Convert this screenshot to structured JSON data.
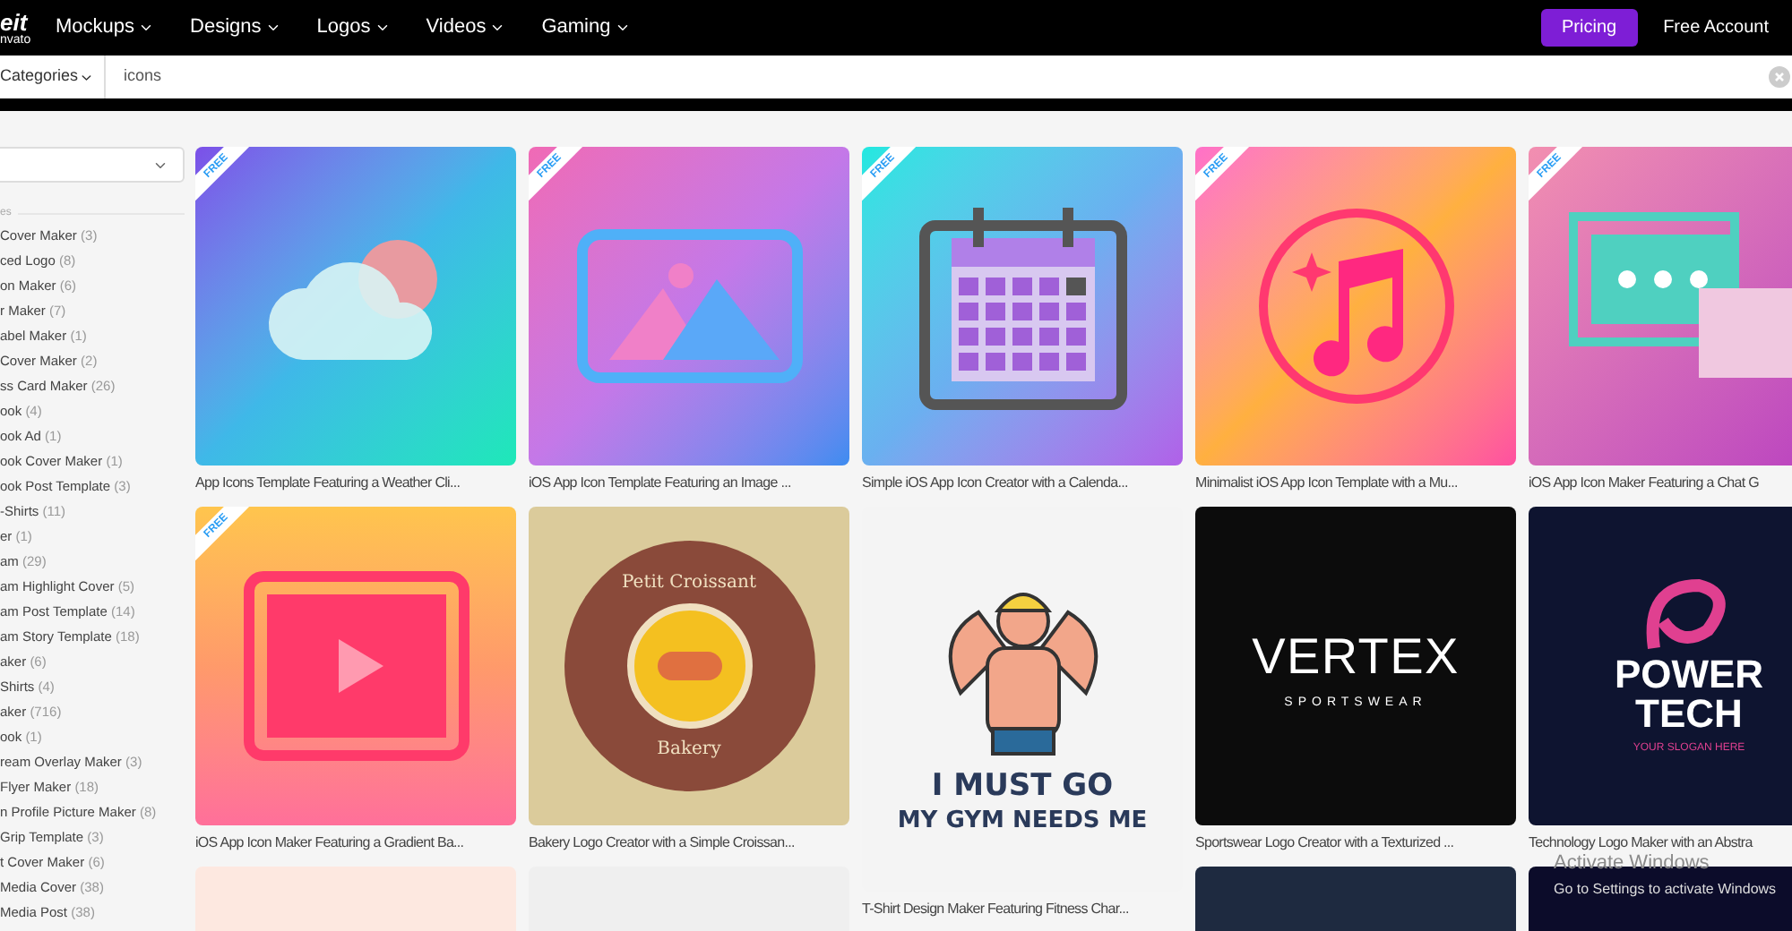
{
  "nav": {
    "logo": "eit",
    "logo_sub": "nvato",
    "items": [
      "Mockups",
      "Designs",
      "Logos",
      "Videos",
      "Gaming"
    ],
    "pricing": "Pricing",
    "account": "Free Account"
  },
  "search": {
    "category": "Categories",
    "value": "icons"
  },
  "sidebar": {
    "heading": "es",
    "items": [
      {
        "label": "Cover Maker",
        "count": "(3)"
      },
      {
        "label": "ced Logo",
        "count": "(8)"
      },
      {
        "label": "on Maker",
        "count": "(6)"
      },
      {
        "label": "r Maker",
        "count": "(7)"
      },
      {
        "label": "abel Maker",
        "count": "(1)"
      },
      {
        "label": "Cover Maker",
        "count": "(2)"
      },
      {
        "label": "ss Card Maker",
        "count": "(26)"
      },
      {
        "label": "ook",
        "count": "(4)"
      },
      {
        "label": "ook Ad",
        "count": "(1)"
      },
      {
        "label": "ook Cover Maker",
        "count": "(1)"
      },
      {
        "label": "ook Post Template",
        "count": "(3)"
      },
      {
        "label": "-Shirts",
        "count": "(11)"
      },
      {
        "label": "er",
        "count": "(1)"
      },
      {
        "label": "am",
        "count": "(29)"
      },
      {
        "label": "am Highlight Cover",
        "count": "(5)"
      },
      {
        "label": "am Post Template",
        "count": "(14)"
      },
      {
        "label": "am Story Template",
        "count": "(18)"
      },
      {
        "label": "aker",
        "count": "(6)"
      },
      {
        "label": "Shirts",
        "count": "(4)"
      },
      {
        "label": "aker",
        "count": "(716)"
      },
      {
        "label": "ook",
        "count": "(1)"
      },
      {
        "label": "ream Overlay Maker",
        "count": "(3)"
      },
      {
        "label": "Flyer Maker",
        "count": "(18)"
      },
      {
        "label": "n Profile Picture Maker",
        "count": "(8)"
      },
      {
        "label": "Grip Template",
        "count": "(3)"
      },
      {
        "label": "t Cover Maker",
        "count": "(6)"
      },
      {
        "label": "Media Cover",
        "count": "(38)"
      },
      {
        "label": "Media Post",
        "count": "(38)"
      }
    ]
  },
  "columns": [
    [
      {
        "kind": "weather",
        "badge": "FREE",
        "caption": "App Icons Template Featuring a Weather Cli..."
      },
      {
        "kind": "video",
        "badge": "FREE",
        "caption": "iOS App Icon Maker Featuring a Gradient Ba..."
      },
      {
        "kind": "peach"
      }
    ],
    [
      {
        "kind": "image",
        "badge": "FREE",
        "caption": "iOS App Icon Template Featuring an Image ..."
      },
      {
        "kind": "bakery",
        "caption": "Bakery Logo Creator with a Simple Croissan...",
        "art_texts": [
          "Petit Croissant",
          "Bakery"
        ]
      },
      {
        "kind": "grey"
      }
    ],
    [
      {
        "kind": "calendar",
        "badge": "FREE",
        "caption": "Simple iOS App Icon Creator with a Calenda..."
      },
      {
        "kind": "gym",
        "caption": "T-Shirt Design Maker Featuring Fitness Char...",
        "art_texts": [
          "I MUST GO",
          "MY GYM NEEDS ME"
        ]
      }
    ],
    [
      {
        "kind": "music",
        "badge": "FREE",
        "caption": "Minimalist iOS App Icon Template with a Mu..."
      },
      {
        "kind": "vertex",
        "caption": "Sportswear Logo Creator with a Texturized ...",
        "art_texts": [
          "VERTEX",
          "SPORTSWEAR"
        ]
      },
      {
        "kind": "navy"
      }
    ],
    [
      {
        "kind": "chat",
        "badge": "FREE",
        "caption": "iOS App Icon Maker Featuring a Chat G"
      },
      {
        "kind": "powertech",
        "caption": "Technology Logo Maker with an Abstra",
        "art_texts": [
          "POWER",
          "TECH",
          "YOUR SLOGAN HERE"
        ]
      },
      {
        "kind": "dark"
      }
    ]
  ],
  "os_overlay": {
    "title": "Activate Windows",
    "subtitle": "Go to Settings to activate Windows"
  }
}
